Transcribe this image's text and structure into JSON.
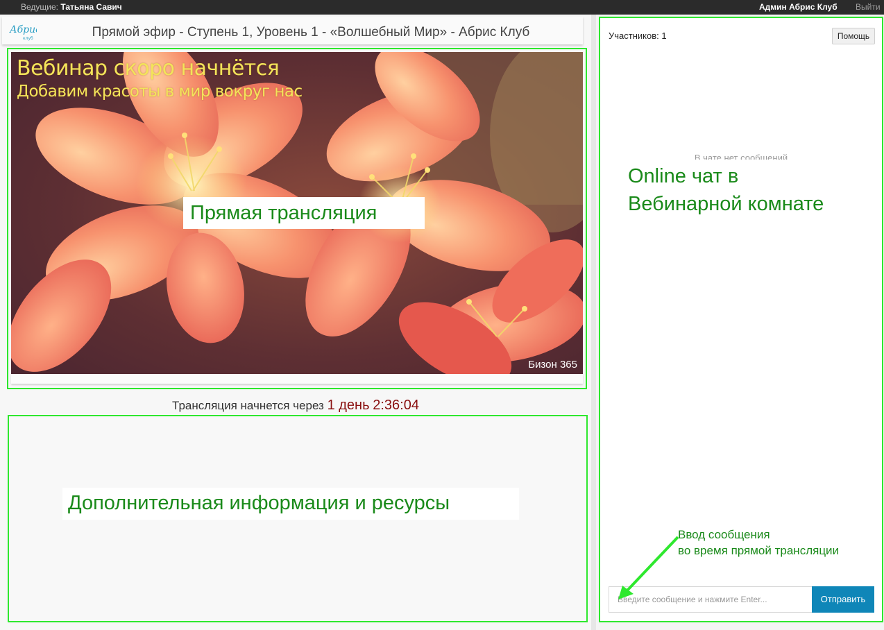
{
  "topbar": {
    "host_label": "Ведущие:",
    "host_name": "Татьяна Савич",
    "user_name": "Админ Абрис Клуб",
    "logout": "Выйти"
  },
  "header": {
    "logo_text": "Абрис",
    "logo_sub": "клуб",
    "title": "Прямой эфир - Ступень 1, Уровень 1 - «Волшебный Мир» - Абрис Клуб"
  },
  "video": {
    "headline": "Вебинар скоро начнётся",
    "subheadline": "Добавим красоты в мир вокруг нас",
    "watermark": "Бизон 365",
    "annotation": "Прямая трансляция"
  },
  "countdown": {
    "prefix": "Трансляция начнется через",
    "days": "1 день",
    "time": "2:36:04"
  },
  "resources": {
    "annotation": "Дополнительная информация и ресурсы"
  },
  "chat": {
    "participants": "Участников: 1",
    "help_button": "Помощь",
    "empty_message": "В чате нет сообщений",
    "annotation_line1": "Online чат в",
    "annotation_line2": "Вебинарной комнате",
    "input_hint_line1": "Ввод сообщения",
    "input_hint_line2": "во время прямой трансляции",
    "input_placeholder": "Введите сообщение и нажмите Enter...",
    "send_button": "Отправить"
  },
  "colors": {
    "annotation_frame": "#2ee82e",
    "annotation_text": "#1a8a1a",
    "send_button": "#0f86b8",
    "countdown_accent": "#8a1010",
    "topbar": "#2b2b2b"
  }
}
